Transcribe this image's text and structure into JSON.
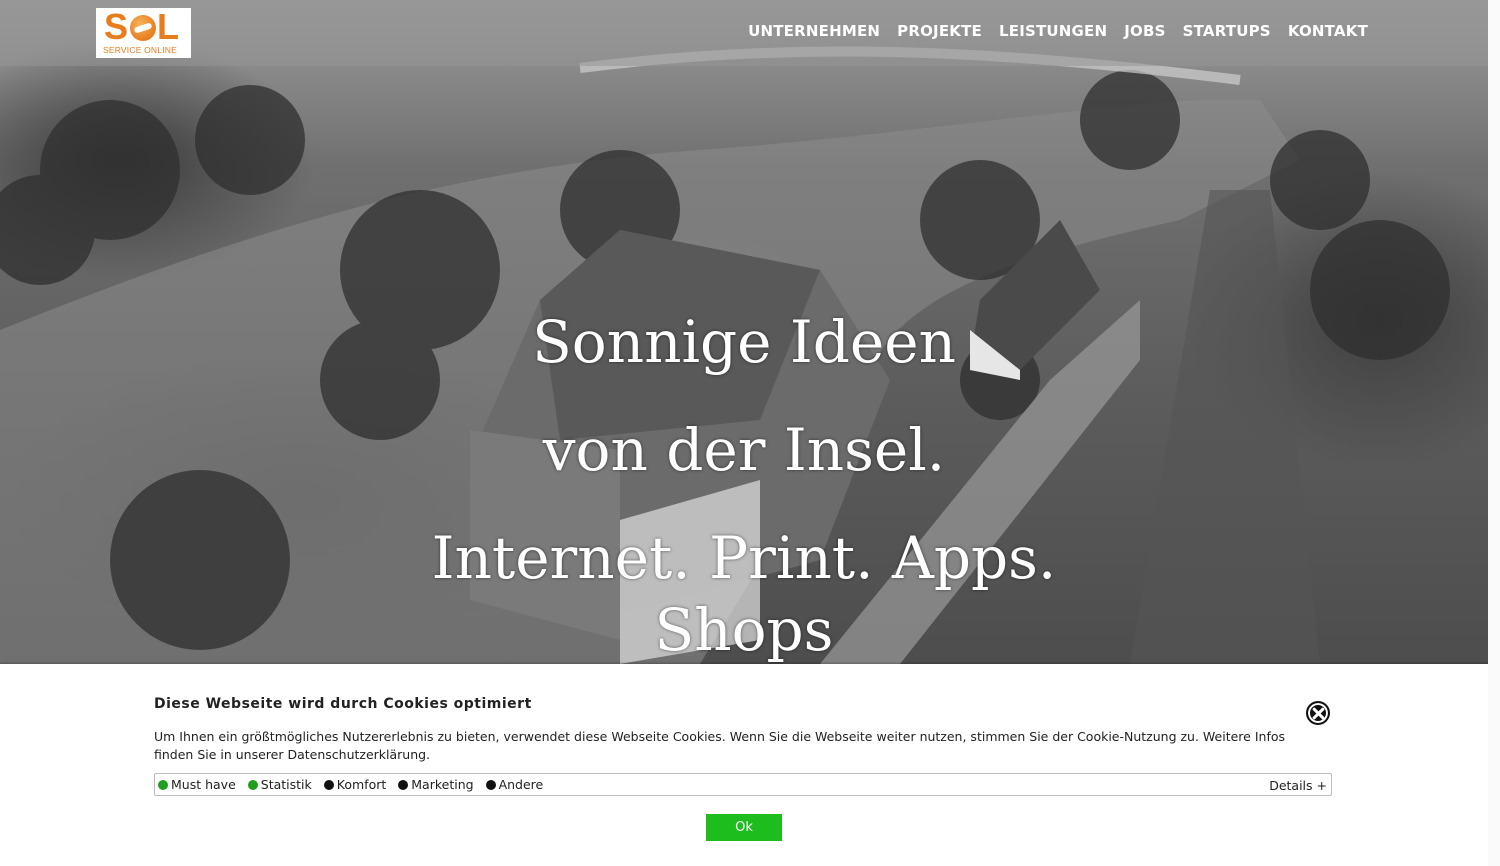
{
  "logo": {
    "word_s": "S",
    "word_l": "L",
    "subtitle": "SERVICE ONLINE"
  },
  "nav": {
    "items": [
      "UNTERNEHMEN",
      "PROJEKTE",
      "LEISTUNGEN",
      "JOBS",
      "STARTUPS",
      "KONTAKT"
    ]
  },
  "hero": {
    "headline_lines": [
      "Sonnige Ideen",
      "von der Insel.",
      "Internet. Print. Apps.",
      "Shops"
    ]
  },
  "cookie": {
    "title": "Diese Webseite wird durch Cookies optimiert",
    "text": "Um Ihnen ein größtmögliches Nutzererlebnis zu bieten, verwendet diese Webseite Cookies. Wenn Sie die Webseite weiter nutzen, stimmen Sie der Cookie-Nutzung zu. Weitere Infos finden Sie in unserer Datenschutzerklärung.",
    "categories": [
      {
        "label": "Must have",
        "color": "#1e9e1e"
      },
      {
        "label": "Statistik",
        "color": "#1e9e1e"
      },
      {
        "label": "Komfort",
        "color": "#111111"
      },
      {
        "label": "Marketing",
        "color": "#111111"
      },
      {
        "label": "Andere",
        "color": "#111111"
      }
    ],
    "details_label": "Details +",
    "ok_label": "Ok",
    "ok_color": "#1ebd1e"
  }
}
